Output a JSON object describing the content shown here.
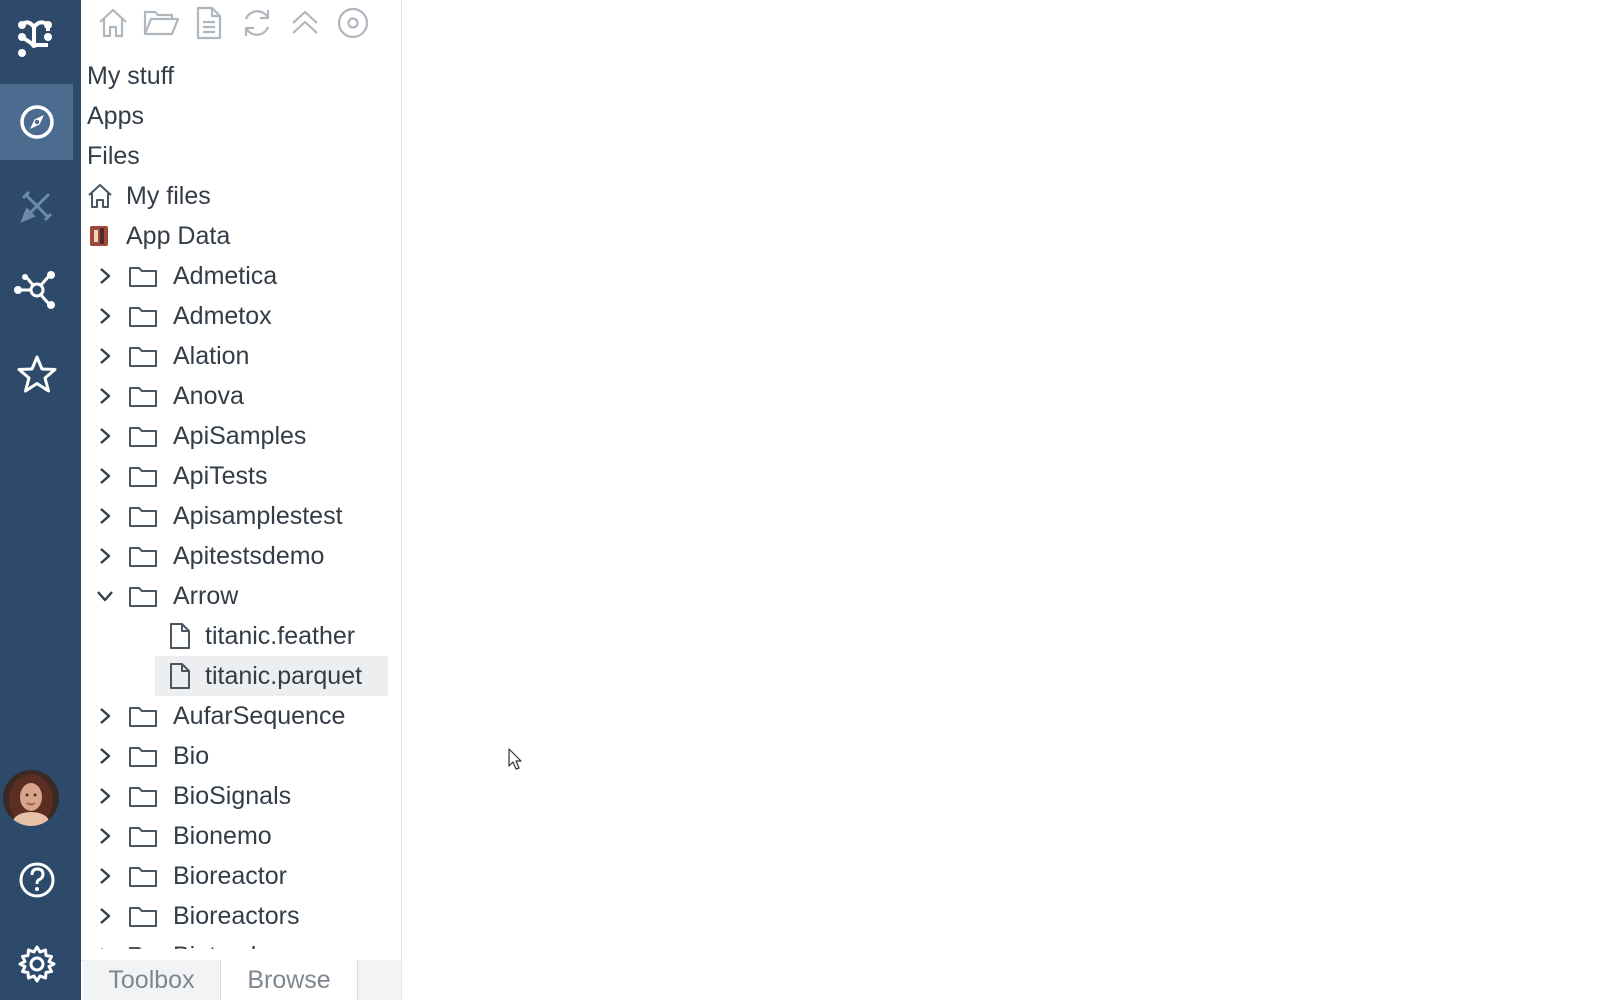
{
  "rail": {
    "logo_icon": "datagrok-logo-icon",
    "items": [
      {
        "name": "browse",
        "icon": "compass-icon",
        "active": true
      },
      {
        "name": "tools",
        "icon": "pencil-ruler-icon",
        "active": false
      },
      {
        "name": "connections",
        "icon": "network-icon",
        "active": false
      },
      {
        "name": "favorites",
        "icon": "star-icon",
        "active": false
      }
    ],
    "bottom": [
      "avatar",
      "help-icon",
      "settings-icon"
    ],
    "colors": {
      "background": "#2d4a6b",
      "active": "#4b6b8f",
      "icon": "#ffffff",
      "icon_dim": "#6d8aa8"
    }
  },
  "toolbar": {
    "icons": [
      "home-icon",
      "open-folder-icon",
      "file-icon",
      "refresh-icon",
      "collapse-up-icon",
      "target-icon"
    ]
  },
  "tree": {
    "sections": [
      "My stuff",
      "Apps",
      "Files"
    ],
    "roots": [
      {
        "label": "My files",
        "icon": "home-icon"
      },
      {
        "label": "App Data",
        "icon": "app-data-icon"
      }
    ],
    "folders_before": [
      "Admetica",
      "Admetox",
      "Alation",
      "Anova",
      "ApiSamples",
      "ApiTests",
      "Apisamplestest",
      "Apitestsdemo"
    ],
    "expanded_folder": {
      "label": "Arrow",
      "files": [
        {
          "label": "titanic.feather",
          "selected": false
        },
        {
          "label": "titanic.parquet",
          "selected": true
        }
      ]
    },
    "folders_after": [
      "AufarSequence",
      "Bio",
      "BioSignals",
      "Bionemo",
      "Bioreactor",
      "Bioreactors",
      "Biotrack"
    ]
  },
  "tabs": {
    "toolbox": "Toolbox",
    "browse": "Browse"
  }
}
